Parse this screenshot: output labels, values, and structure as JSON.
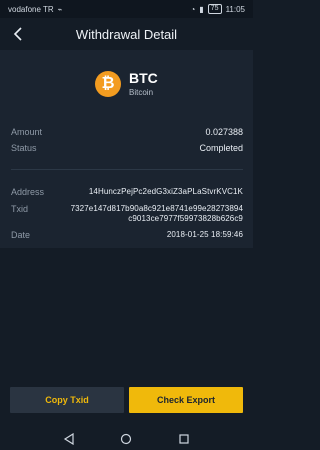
{
  "status_bar": {
    "carrier": "vodafone TR",
    "battery": "75",
    "time": "11:05"
  },
  "header": {
    "title": "Withdrawal Detail"
  },
  "coin": {
    "logo_glyph": "₿",
    "symbol": "BTC",
    "name": "Bitcoin",
    "logo_color": "#f39c20"
  },
  "summary": {
    "amount_label": "Amount",
    "amount_value": "0.027388",
    "status_label": "Status",
    "status_value": "Completed"
  },
  "details": {
    "address_label": "Address",
    "address_value": "14HunczPejPc2edG3xiZ3aPLaStvrKVC1K",
    "txid_label": "Txid",
    "txid_line1": "7327e147d817b90a8c921e8741e99e28273894",
    "txid_line2": "c9013ce7977f59973828b626c9",
    "date_label": "Date",
    "date_value": "2018-01-25 18:59:46"
  },
  "actions": {
    "copy_label": "Copy Txid",
    "export_label": "Check Export"
  },
  "colors": {
    "accent": "#f0b90b",
    "background": "#141c26",
    "card": "#1b2430"
  }
}
